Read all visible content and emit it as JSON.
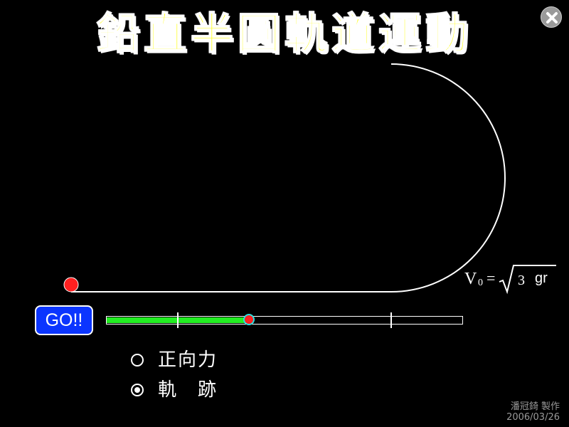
{
  "title": "鉛直半圓軌道運動",
  "close_button": {
    "icon": "close-icon"
  },
  "formula": {
    "lhs": "V",
    "subscript": "0",
    "equals": "=",
    "coefficient": "3",
    "variables": "gr"
  },
  "go_button": {
    "label": "GO!!"
  },
  "slider": {
    "value": 0.4,
    "tick_positions": [
      0.2,
      0.8
    ]
  },
  "options": [
    {
      "label": "正向力",
      "checked": false
    },
    {
      "label": "軌　跡",
      "checked": true
    }
  ],
  "credit": {
    "author": "潘冠錡 製作",
    "date": "2006/03/26"
  },
  "colors": {
    "background": "#000000",
    "title": "#ffff00",
    "go_button": "#0b35ff",
    "slider_fill": "#22ee22",
    "ball": "#ff2020",
    "thumb_ring": "#29e0e0"
  }
}
